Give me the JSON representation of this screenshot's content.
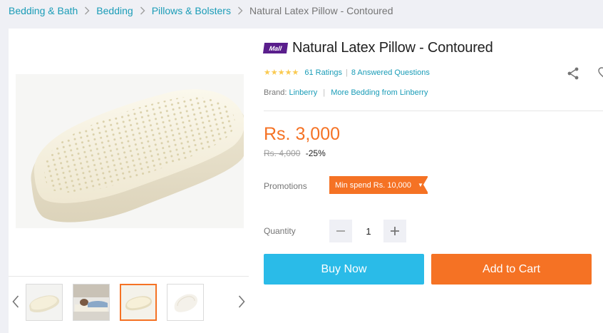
{
  "breadcrumb": {
    "items": [
      "Bedding & Bath",
      "Bedding",
      "Pillows & Bolsters"
    ],
    "current": "Natural Latex Pillow - Contoured"
  },
  "product": {
    "badge": "Mall",
    "title": "Natural Latex Pillow - Contoured",
    "rating_value": 4.5,
    "ratings_text": "61 Ratings",
    "questions_text": "8 Answered Questions",
    "brand_label": "Brand:",
    "brand_name": "Linberry",
    "more_from": "More Bedding from Linberry",
    "price": "Rs. 3,000",
    "old_price": "Rs. 4,000",
    "discount": "-25%"
  },
  "promotions": {
    "label": "Promotions",
    "tag": "Min spend Rs. 10,000"
  },
  "quantity": {
    "label": "Quantity",
    "value": "1"
  },
  "actions": {
    "buy_now": "Buy Now",
    "add_to_cart": "Add to Cart"
  },
  "gallery": {
    "thumbnails": [
      "pillow-angle",
      "person-on-pillow",
      "pillow-front",
      "pillow-top"
    ],
    "active_index": 2
  },
  "colors": {
    "accent_orange": "#f57224",
    "link_blue": "#1a9cb7",
    "buy_blue": "#2abbe8",
    "mall_purple": "#5a1e8c",
    "star_yellow": "#faca51"
  },
  "icons": [
    "chevron-right-icon",
    "share-icon",
    "heart-icon",
    "star-icon",
    "minus-icon",
    "plus-icon",
    "chevron-left-icon",
    "caret-down-icon"
  ]
}
